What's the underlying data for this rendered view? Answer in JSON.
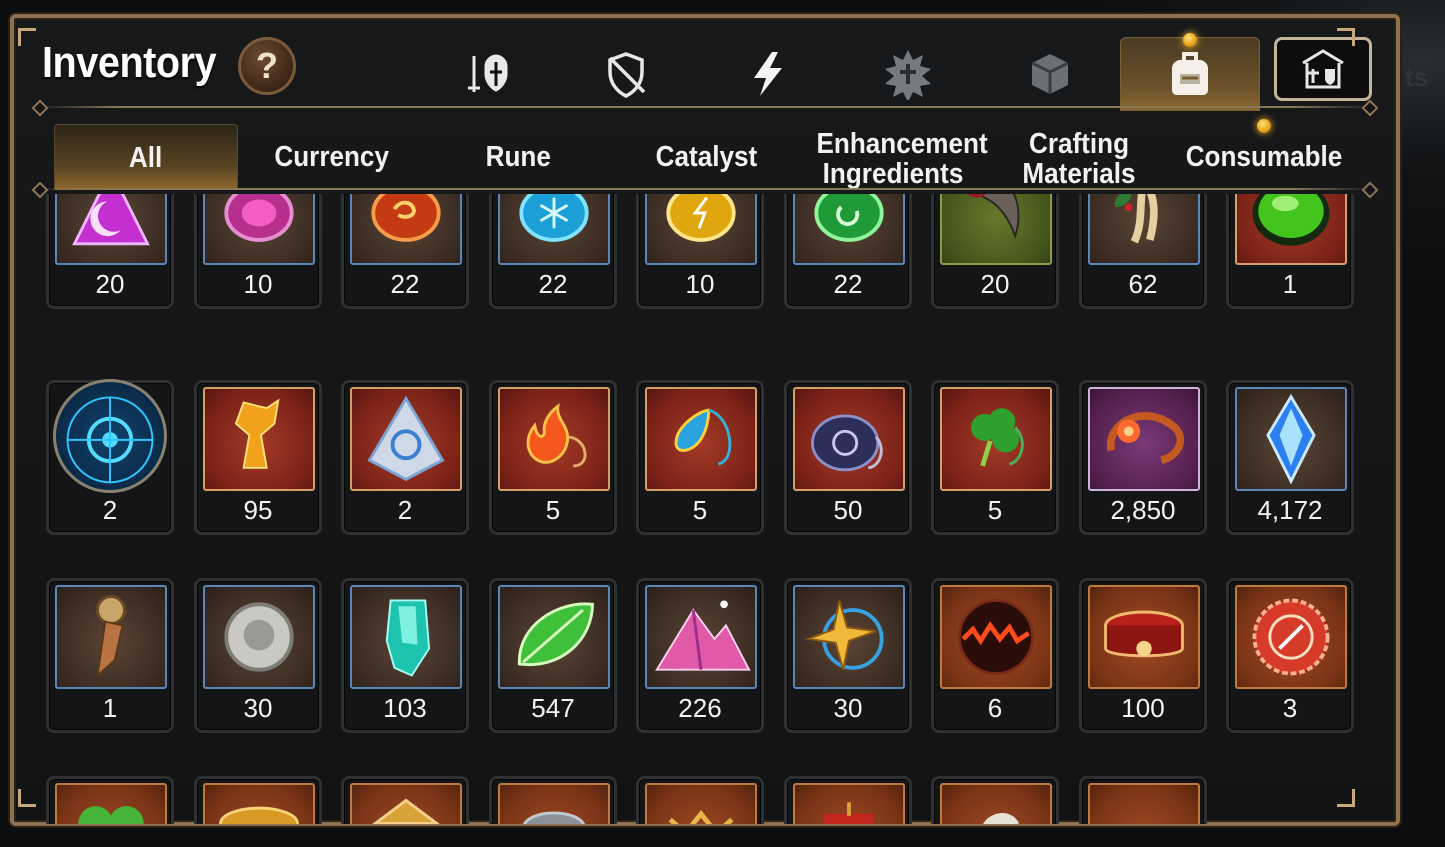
{
  "header": {
    "title": "Inventory",
    "help_label": "?"
  },
  "category_icons": [
    {
      "name": "equipment-icon",
      "active": false
    },
    {
      "name": "shield-off-icon",
      "active": false
    },
    {
      "name": "lightning-icon",
      "active": false
    },
    {
      "name": "spiky-emblem-icon",
      "active": false
    },
    {
      "name": "cube-icon",
      "active": false
    },
    {
      "name": "backpack-icon",
      "active": true
    },
    {
      "name": "shop-icon",
      "active": false
    }
  ],
  "tabs": [
    {
      "label": "All",
      "active": true
    },
    {
      "label": "Currency",
      "active": false
    },
    {
      "label": "Rune",
      "active": false
    },
    {
      "label": "Catalyst",
      "active": false
    },
    {
      "label": "Enhancement Ingredients",
      "active": false
    },
    {
      "label": "Crafting Materials",
      "active": false
    },
    {
      "label": "Consumable",
      "active": false
    }
  ],
  "items": [
    {
      "icon": "purple-triangle-gem-icon",
      "qty": "20",
      "frame": "blue"
    },
    {
      "icon": "pink-gem-icon",
      "qty": "10",
      "frame": "blue"
    },
    {
      "icon": "red-orange-gem-icon",
      "qty": "22",
      "frame": "blue"
    },
    {
      "icon": "blue-snowflake-gem-icon",
      "qty": "22",
      "frame": "blue"
    },
    {
      "icon": "yellow-gem-icon",
      "qty": "10",
      "frame": "blue"
    },
    {
      "icon": "green-gem-icon",
      "qty": "22",
      "frame": "blue"
    },
    {
      "icon": "claw-icon",
      "qty": "20",
      "frame": "green"
    },
    {
      "icon": "ginseng-root-icon",
      "qty": "62",
      "frame": "blue"
    },
    {
      "icon": "green-potion-orb-icon",
      "qty": "1",
      "frame": "red"
    },
    {
      "icon": "blue-rune-disc-icon",
      "qty": "2",
      "frame": "round"
    },
    {
      "icon": "amber-crystal-icon",
      "qty": "95",
      "frame": "red"
    },
    {
      "icon": "triangle-crystal-icon",
      "qty": "2",
      "frame": "red"
    },
    {
      "icon": "fire-pendant-icon",
      "qty": "5",
      "frame": "red"
    },
    {
      "icon": "water-pendant-icon",
      "qty": "5",
      "frame": "red"
    },
    {
      "icon": "spiral-pendant-icon",
      "qty": "50",
      "frame": "red"
    },
    {
      "icon": "clover-pendant-icon",
      "qty": "5",
      "frame": "red"
    },
    {
      "icon": "flower-ring-icon",
      "qty": "2,850",
      "frame": "purple"
    },
    {
      "icon": "blue-crystal-shard-icon",
      "qty": "4,172",
      "frame": "blue"
    },
    {
      "icon": "compass-key-icon",
      "qty": "1",
      "frame": "blue"
    },
    {
      "icon": "silver-coin-icon",
      "qty": "30",
      "frame": "blue"
    },
    {
      "icon": "teal-crystal-icon",
      "qty": "103",
      "frame": "blue"
    },
    {
      "icon": "green-leaf-icon",
      "qty": "547",
      "frame": "blue"
    },
    {
      "icon": "pink-mountain-dust-icon",
      "qty": "226",
      "frame": "blue"
    },
    {
      "icon": "star-pendant-icon",
      "qty": "30",
      "frame": "blue"
    },
    {
      "icon": "lava-orb-icon",
      "qty": "6",
      "frame": "brown"
    },
    {
      "icon": "red-bracelet-icon",
      "qty": "100",
      "frame": "brown"
    },
    {
      "icon": "red-badge-icon",
      "qty": "3",
      "frame": "brown"
    },
    {
      "icon": "green-clover-icon",
      "qty": "",
      "frame": "brown"
    },
    {
      "icon": "gold-coin-icon",
      "qty": "",
      "frame": "brown"
    },
    {
      "icon": "gold-chest-icon",
      "qty": "",
      "frame": "brown"
    },
    {
      "icon": "grey-helmet-icon",
      "qty": "",
      "frame": "brown"
    },
    {
      "icon": "gold-crown-icon",
      "qty": "",
      "frame": "brown"
    },
    {
      "icon": "red-banner-icon",
      "qty": "",
      "frame": "brown"
    },
    {
      "icon": "white-horse-icon",
      "qty": "",
      "frame": "brown"
    },
    {
      "icon": "red-bow-icon",
      "qty": "",
      "frame": "brown"
    }
  ],
  "colors": {
    "panel_border": "#8e7350",
    "accent_gold": "#e7a11a",
    "tab_active": "#8f6a2c",
    "frame_blue": "#5a86b8",
    "frame_red": "#d3a067"
  }
}
